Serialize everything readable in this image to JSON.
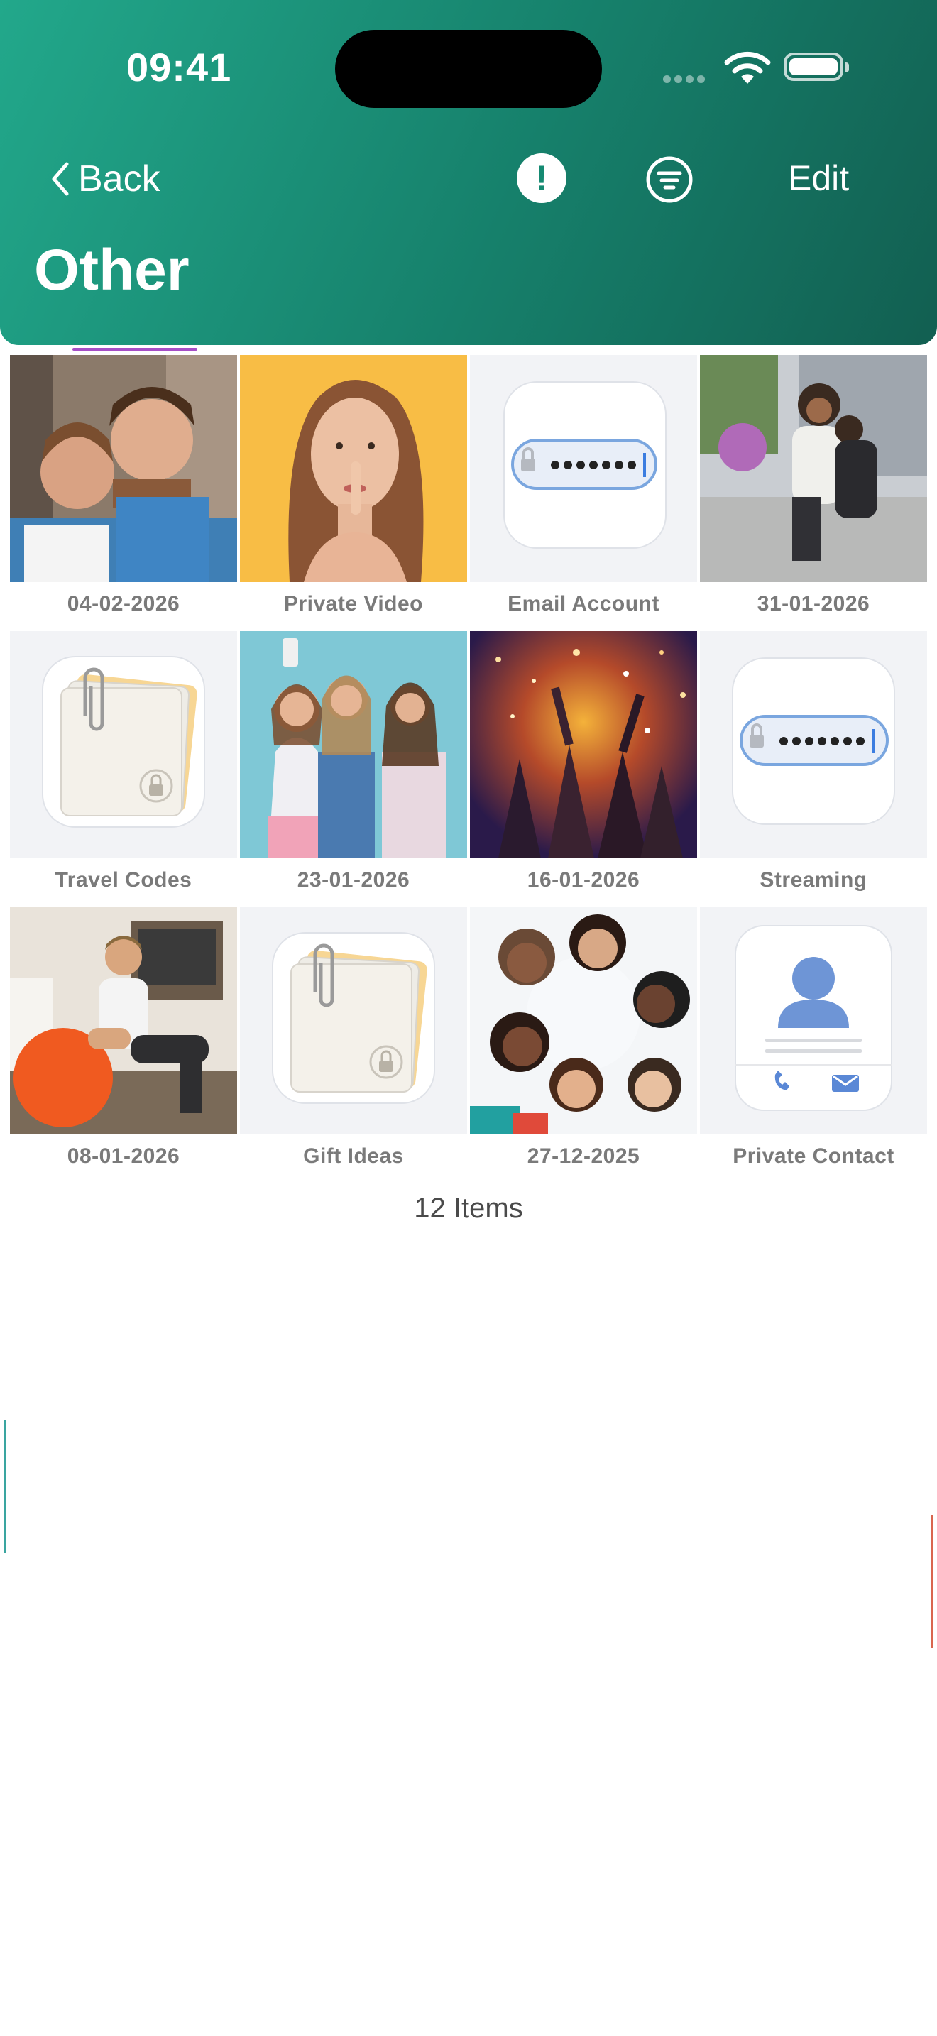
{
  "status_bar": {
    "time": "09:41"
  },
  "nav": {
    "back_label": "Back",
    "info_icon": "exclamation",
    "edit_label": "Edit"
  },
  "page": {
    "title": "Other"
  },
  "items": [
    {
      "label": "04-02-2026",
      "type": "photo"
    },
    {
      "label": "Private Video",
      "type": "video"
    },
    {
      "label": "Email Account",
      "type": "password-icon"
    },
    {
      "label": "31-01-2026",
      "type": "photo"
    },
    {
      "label": "Travel Codes",
      "type": "note-icon"
    },
    {
      "label": "23-01-2026",
      "type": "photo"
    },
    {
      "label": "16-01-2026",
      "type": "photo"
    },
    {
      "label": "Streaming",
      "type": "password-icon"
    },
    {
      "label": "08-01-2026",
      "type": "photo"
    },
    {
      "label": "Gift Ideas",
      "type": "note-icon"
    },
    {
      "label": "27-12-2025",
      "type": "photo"
    },
    {
      "label": "Private Contact",
      "type": "contact-icon"
    }
  ],
  "footer": {
    "count_label": "12 Items"
  },
  "colors": {
    "header_start": "#22a88b",
    "header_end": "#125f51",
    "accent": "#a64ec7"
  }
}
